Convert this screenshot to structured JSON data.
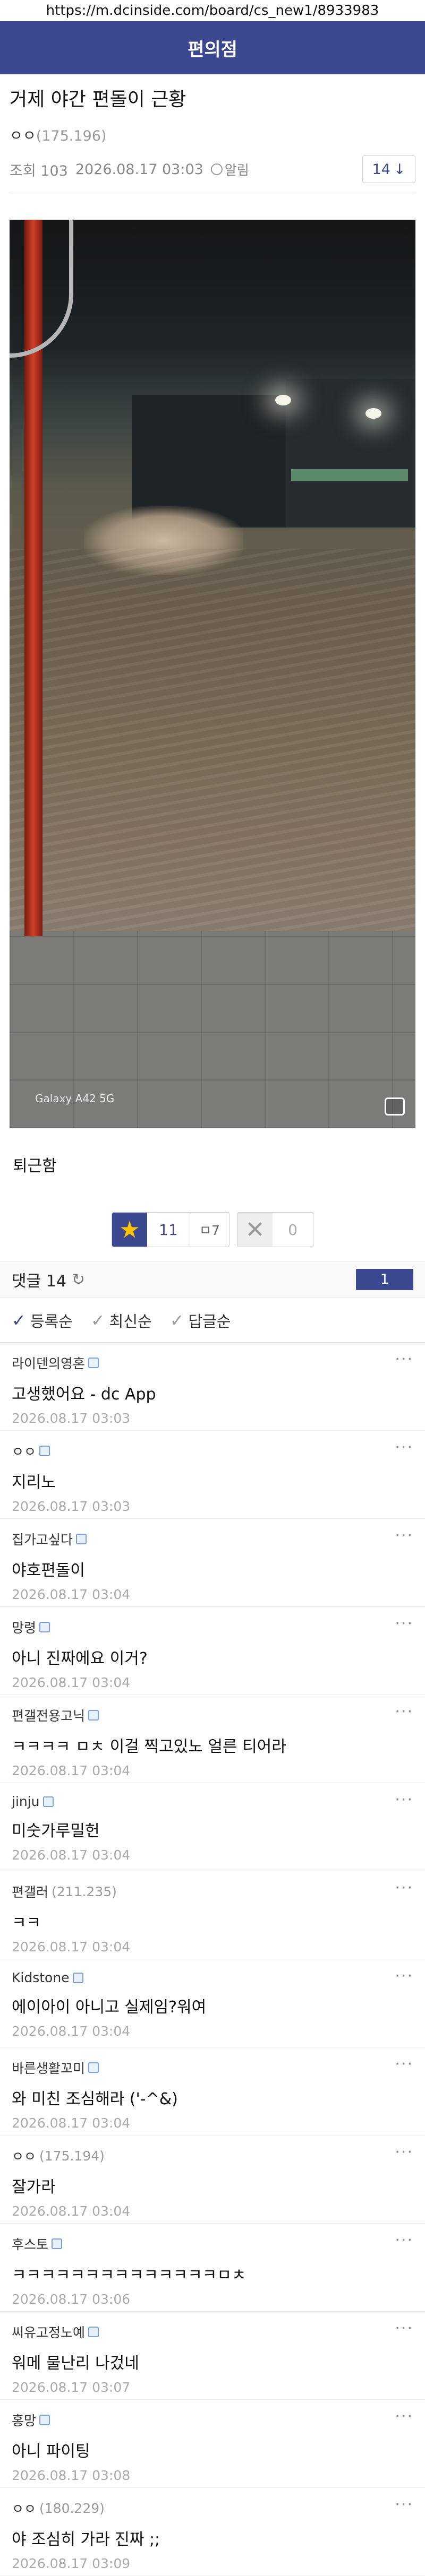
{
  "url": "https://m.dcinside.com/board/cs_new1/8933983",
  "board_name": "편의점",
  "post": {
    "title": "거제 야간 편돌이 근황",
    "author": "ㅇㅇ",
    "author_ip": "(175.196)",
    "views": "조회 103",
    "datetime": "2026.08.17 03:03",
    "alarm_label": "알림",
    "comment_count_badge": "14",
    "body": "퇴근함",
    "photo_watermark": "Galaxy A42 5G"
  },
  "votes": {
    "up": "11",
    "fixed_up": "ㅁ7",
    "down": "0"
  },
  "comments_header": {
    "title": "댓글 14",
    "page": "1"
  },
  "sort_options": [
    "등록순",
    "최신순",
    "답글순"
  ],
  "comments": [
    {
      "nick": "라이덴의영혼",
      "ip": "",
      "gall": true,
      "text": "고생했어요 - dc App",
      "date": "2026.08.17 03:03"
    },
    {
      "nick": "ㅇㅇ",
      "ip": "",
      "gall": true,
      "text": "지리노",
      "date": "2026.08.17 03:03"
    },
    {
      "nick": "집가고싶다",
      "ip": "",
      "gall": true,
      "text": "야호편돌이",
      "date": "2026.08.17 03:04"
    },
    {
      "nick": "망령",
      "ip": "",
      "gall": true,
      "text": "아니 진짜에요 이거?",
      "date": "2026.08.17 03:04"
    },
    {
      "nick": "편갤전용고닉",
      "ip": "",
      "gall": true,
      "text": "ㅋㅋㅋㅋ ㅁㅊ 이걸 찍고있노 얼른 티어라",
      "date": "2026.08.17 03:04"
    },
    {
      "nick": "jinju",
      "ip": "",
      "gall": true,
      "text": "미숫가루밀헌",
      "date": "2026.08.17 03:04"
    },
    {
      "nick": "편갤러",
      "ip": "(211.235)",
      "gall": false,
      "text": "ㅋㅋ",
      "date": "2026.08.17 03:04"
    },
    {
      "nick": "Kidstone",
      "ip": "",
      "gall": true,
      "text": "에이아이 아니고 실제임?워여",
      "date": "2026.08.17 03:04"
    },
    {
      "nick": "바른생활꼬미",
      "ip": "",
      "gall": true,
      "text": "와 미친 조심해라 ('-^&)",
      "date": "2026.08.17 03:04"
    },
    {
      "nick": "ㅇㅇ",
      "ip": "(175.194)",
      "gall": false,
      "text": "잘가라",
      "date": "2026.08.17 03:04"
    },
    {
      "nick": "후스토",
      "ip": "",
      "gall": true,
      "text": "ㅋㅋㅋㅋㅋㅋㅋㅋㅋㅋㅋㅋㅋㅋㅁㅊ",
      "date": "2026.08.17 03:06"
    },
    {
      "nick": "씨유고정노예",
      "ip": "",
      "gall": true,
      "text": "워메 물난리 나겄네",
      "date": "2026.08.17 03:07"
    },
    {
      "nick": "홍망",
      "ip": "",
      "gall": true,
      "text": "아니 파이팅",
      "date": "2026.08.17 03:08"
    },
    {
      "nick": "ㅇㅇ",
      "ip": "(180.229)",
      "gall": false,
      "text": "야 조심히 가라 진짜 ;;",
      "date": "2026.08.17 03:09"
    }
  ]
}
